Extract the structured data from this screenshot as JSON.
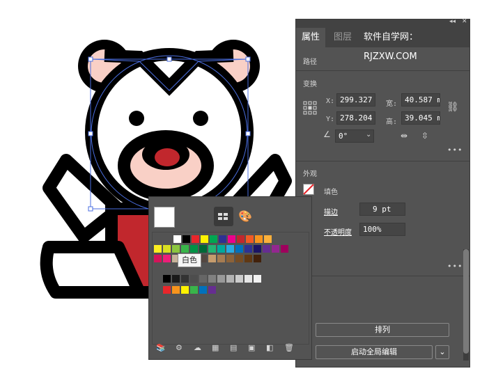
{
  "panel": {
    "tabs": [
      "属性",
      "图层"
    ],
    "watermark": "软件自学网：RJZXW.COM",
    "section_path": "路径",
    "section_transform": "变换",
    "x_label": "X:",
    "x_value": "299.327",
    "y_label": "Y:",
    "y_value": "278.204",
    "w_label": "宽:",
    "w_value": "40.587 m",
    "h_label": "高:",
    "h_value": "39.045 m",
    "angle_value": "0°",
    "section_appearance": "外观",
    "fill_label": "填色",
    "stroke_label": "描边",
    "stroke_value": "9 pt",
    "opacity_label": "不透明度",
    "opacity_value": "100%",
    "arrange_button": "排列",
    "global_edit_button": "启动全局编辑"
  },
  "swatches": {
    "tooltip": "白色",
    "colors": {
      "row1": [
        "#ffffff",
        "#000000",
        "#e8262b",
        "#fff200",
        "#00a651",
        "#2e3192",
        "#ec008c",
        "#c1272d",
        "#f15a24",
        "#f7941d",
        "#fbb03b"
      ],
      "row2": [
        "#fcee21",
        "#d9e021",
        "#8cc63f",
        "#39b54a",
        "#009245",
        "#006837",
        "#22b573",
        "#00a99d",
        "#29abe2",
        "#0071bc",
        "#2e3192",
        "#1b1464",
        "#662d91",
        "#93278f",
        "#9e005d"
      ],
      "row3": [
        "#d4145a",
        "#ed1e79",
        "#c7b299",
        "#998675",
        "#736357",
        "#534741",
        "#c69c6d",
        "#a67c52",
        "#8c6239",
        "#754c24",
        "#603813",
        "#42210b"
      ],
      "gray": [
        "#000000",
        "#1a1a1a",
        "#333333",
        "#4d4d4d",
        "#666666",
        "#808080",
        "#999999",
        "#b3b3b3",
        "#cccccc",
        "#e6e6e6",
        "#f2f2f2"
      ],
      "bright": [
        "#e8262b",
        "#f7941d",
        "#fff200",
        "#39b54a",
        "#0071bc",
        "#662d91"
      ]
    }
  },
  "icons": [
    "double-arrow-icon",
    "close-icon",
    "reference-point-icon",
    "link-icon",
    "angle-icon",
    "flip-horizontal-icon",
    "flip-vertical-icon",
    "more-icon",
    "fill-none-icon",
    "menu-icon",
    "swatch-view-icon",
    "color-palette-icon",
    "swatch-library-icon",
    "new-color-group-icon",
    "delete-icon"
  ]
}
